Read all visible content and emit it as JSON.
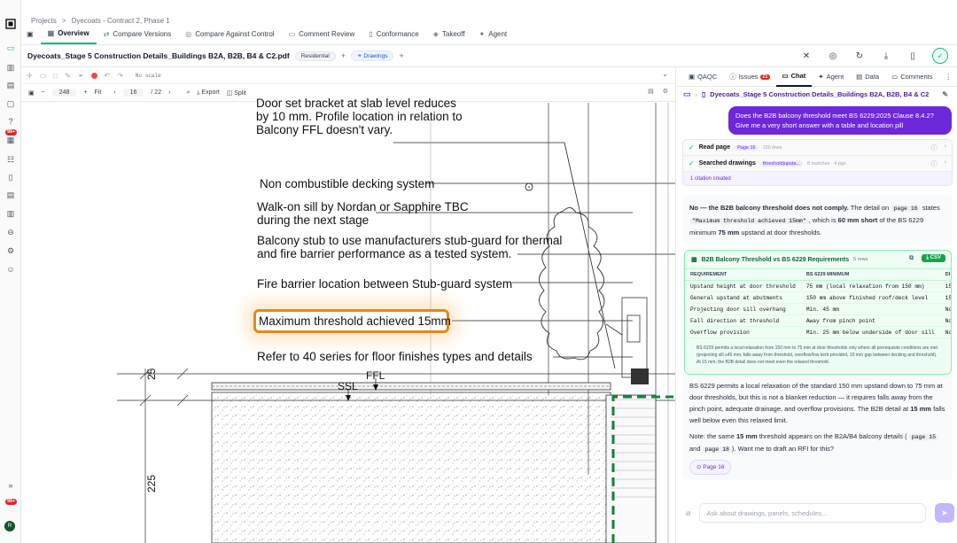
{
  "breadcrumb": {
    "root": "Projects",
    "sep": ">",
    "current": "Dyecoats - Contract 2, Phase 1"
  },
  "rail_badges": {
    "top": "99+",
    "bottom": "99+"
  },
  "avatar_initial": "R",
  "tabs": [
    {
      "label": "Overview",
      "icon": "grid-icon"
    },
    {
      "label": "Compare Versions",
      "icon": "compare-icon"
    },
    {
      "label": "Compare Against Control",
      "icon": "target-icon"
    },
    {
      "label": "Comment Review",
      "icon": "comment-icon"
    },
    {
      "label": "Conformance",
      "icon": "doc-icon"
    },
    {
      "label": "Takeoff",
      "icon": "ruler-icon"
    },
    {
      "label": "Agent",
      "icon": "agent-icon"
    }
  ],
  "file": {
    "name": "Dyecoats_Stage 5 Construction Details_Buildings B2A, B2B, B4 & C2.pdf",
    "tag": "Residential",
    "drawings": "Drawings"
  },
  "viewer": {
    "scale": "No scale",
    "zoom": "248",
    "fit": "Fit",
    "page": "16",
    "page_total": "/ 22",
    "export": "Export",
    "split": "Split"
  },
  "drawing": {
    "line1": "Door set bracket at slab level reduces",
    "line2": "by 10 mm. Profile location in relation to",
    "line3": "Balcony FFL doesn't vary.",
    "line4": "Non combustible decking system",
    "line5a": "Walk-on sill by Nordan or Sapphire TBC",
    "line5b": "during the next stage",
    "line6a": "Balcony stub to use manufacturers stub-guard for thermal",
    "line6b": "and fire barrier performance as a tested system.",
    "line7": "Fire barrier location between Stub-guard system",
    "line8": "Maximum threshold achieved 15mm",
    "line9": "Refer to 40 series for floor finishes types and details",
    "ssl": "SSL",
    "ffl": "FFL",
    "dim25": "25",
    "dim225": "225"
  },
  "panel": {
    "tabs": [
      {
        "label": "QAQC"
      },
      {
        "label": "Issues",
        "count": "21"
      },
      {
        "label": "Chat"
      },
      {
        "label": "Agent"
      },
      {
        "label": "Data"
      },
      {
        "label": "Comments"
      }
    ],
    "crumb": "Dyecoats_Stage 5 Construction Details_Buildings B2A, B2B, B4 & C2",
    "question": "Does the B2B balcony threshold meet BS 6229:2025 Clause 8.4.2? Give me a very short answer with a table and location pill",
    "steps": [
      {
        "label": "Read page",
        "tag": "Page 16",
        "meta": "150 lines"
      },
      {
        "label": "Searched drawings",
        "tag": "threshold|upsta...",
        "meta": "8 matches · 4 pgs"
      }
    ],
    "citation": "1 citation created",
    "answer1": {
      "bold": "No — the B2B balcony threshold does not comply.",
      "t1": "The detail on",
      "code1": "page 16",
      "t2": "states",
      "code2": "\"Maximum threshold achieved 15mm\"",
      "t3": ", which is",
      "b2": "60 mm short",
      "t4": "of the BS 6229 minimum",
      "b3": "75 mm",
      "t5": "upstand at door thresholds."
    },
    "table": {
      "title": "B2B Balcony Threshold vs BS 6229 Requirements",
      "rows_count": "5 rows",
      "csv": "CSV",
      "headers": [
        "REQUIREMENT",
        "BS 6229 MINIMUM",
        "DI"
      ],
      "rows": [
        [
          "Upstand height at door threshold",
          "75 mm (local relaxation from 150 mm)",
          "15"
        ],
        [
          "General upstand at abutments",
          "150 mm above finished roof/deck level",
          "15"
        ],
        [
          "Projecting door sill overhang",
          "Min. 45 mm",
          "No"
        ],
        [
          "Fall direction at threshold",
          "Away from pinch point",
          "No"
        ],
        [
          "Overflow provision",
          "Min. 25 mm below underside of door sill",
          "No"
        ]
      ],
      "note": "BS 6229 permits a local relaxation from 150 mm to 75 mm at door thresholds only where all prerequisite conditions are met (projecting sill ≥45 mm, falls away from threshold, overflow/low kerb provided, 10 mm gap between decking and threshold). At 15 mm, the B2B detail does not meet even the relaxed threshold."
    },
    "answer2": {
      "p1": "BS 6229 permits a local relaxation of the standard 150 mm upstand down to 75 mm at door thresholds, but this is not a blanket reduction — it requires falls away from the pinch point, adequate drainage, and overflow provisions. The B2B detail at",
      "p1b": "15 mm",
      "p1c": "falls well below even this relaxed limit.",
      "p2a": "Note: the same",
      "p2b": "15 mm",
      "p2c": "threshold appears on the B2A/B4 balcony details (",
      "code1": "page 15",
      "and": "and",
      "code2": "page 18",
      "p2d": "). Want me to draft an RFI for this?",
      "pill": "Page 16"
    },
    "composer_placeholder": "Ask about drawings, panels, schedules..."
  }
}
